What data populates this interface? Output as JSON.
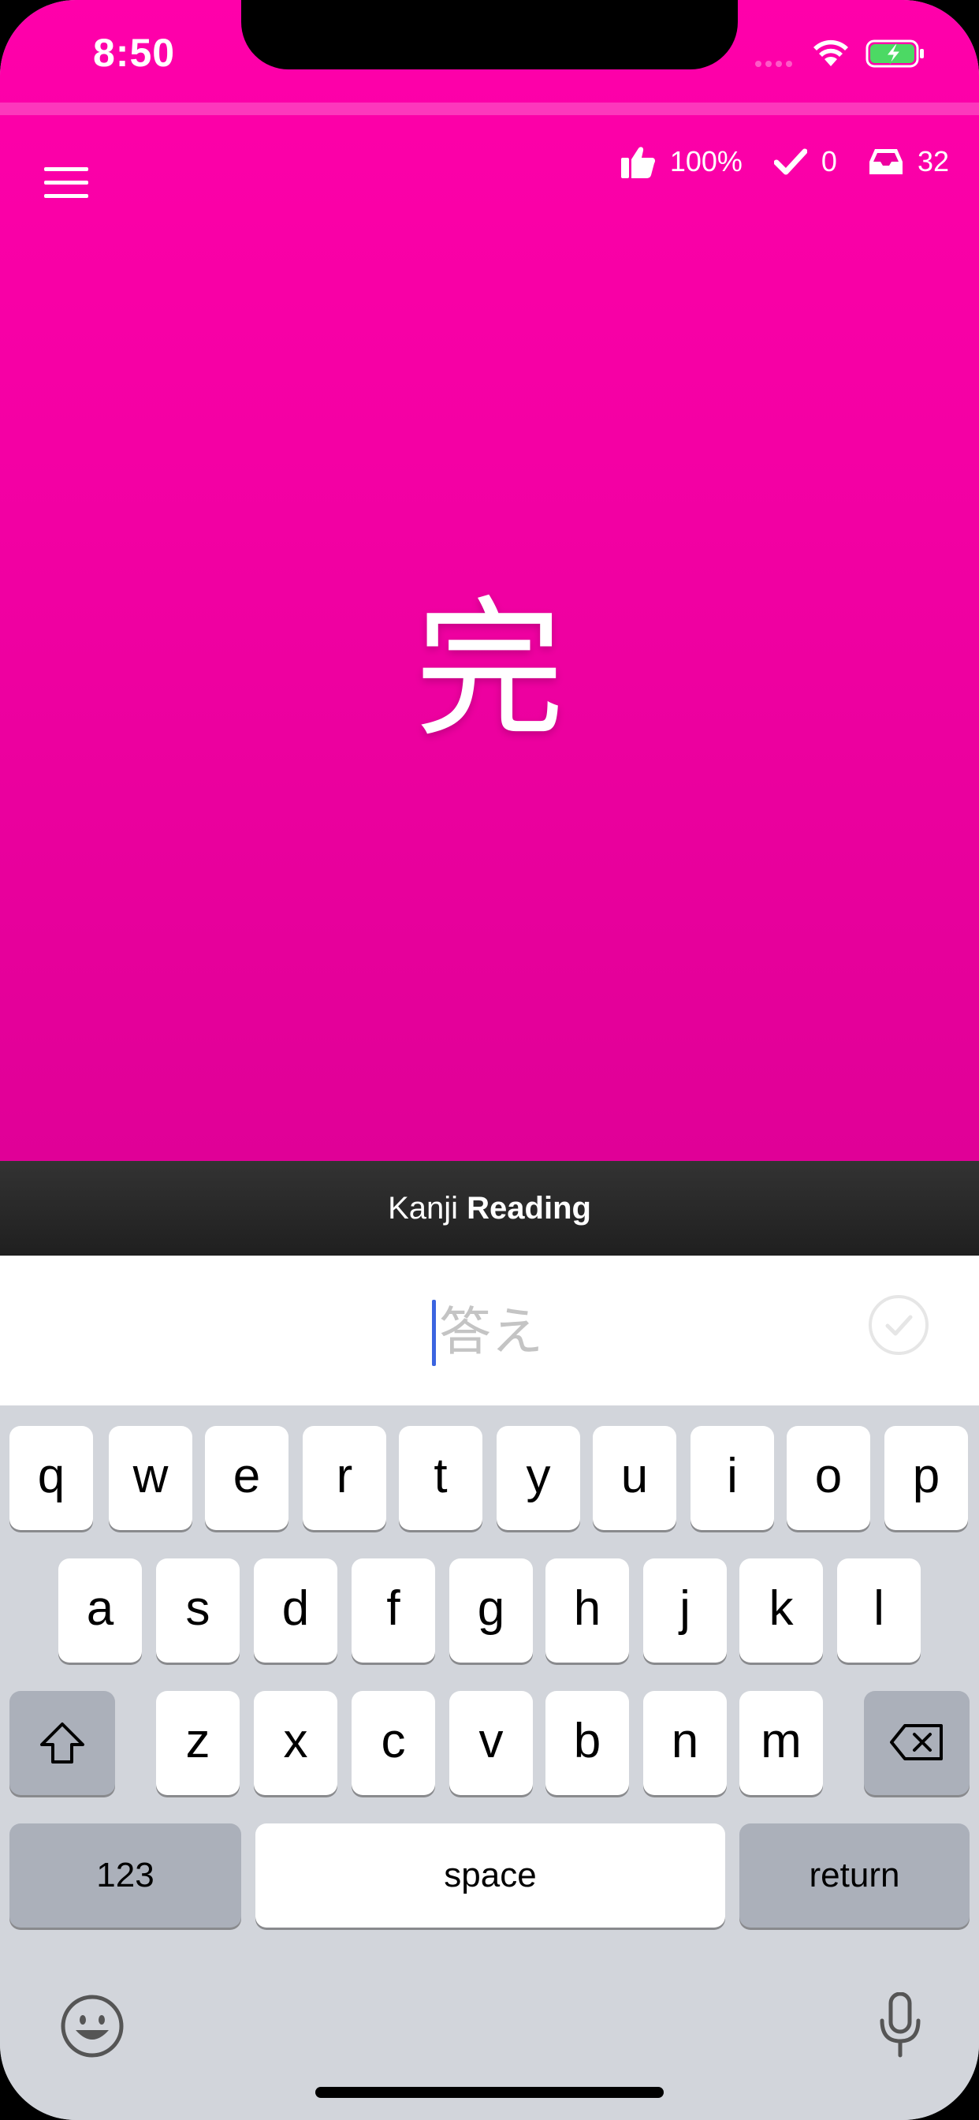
{
  "status": {
    "time": "8:50"
  },
  "stats": {
    "accuracy": "100%",
    "correct": "0",
    "remaining": "32"
  },
  "card": {
    "kanji": "完"
  },
  "mode": {
    "subject": "Kanji",
    "task": "Reading"
  },
  "answer": {
    "placeholder": "答え",
    "value": ""
  },
  "keyboard": {
    "row1": [
      "q",
      "w",
      "e",
      "r",
      "t",
      "y",
      "u",
      "i",
      "o",
      "p"
    ],
    "row2": [
      "a",
      "s",
      "d",
      "f",
      "g",
      "h",
      "j",
      "k",
      "l"
    ],
    "row3": [
      "z",
      "x",
      "c",
      "v",
      "b",
      "n",
      "m"
    ],
    "numbers_label": "123",
    "space_label": "space",
    "return_label": "return"
  },
  "colors": {
    "card_top": "#ff00aa",
    "card_bottom": "#e00097",
    "mode_bar": "#262626",
    "caret": "#3b64e0"
  },
  "icons": [
    "menu-icon",
    "thumbs-up-icon",
    "checkmark-icon",
    "inbox-icon",
    "wifi-icon",
    "battery-charging-icon",
    "shift-icon",
    "backspace-icon",
    "emoji-icon",
    "microphone-icon",
    "submit-check-icon"
  ]
}
